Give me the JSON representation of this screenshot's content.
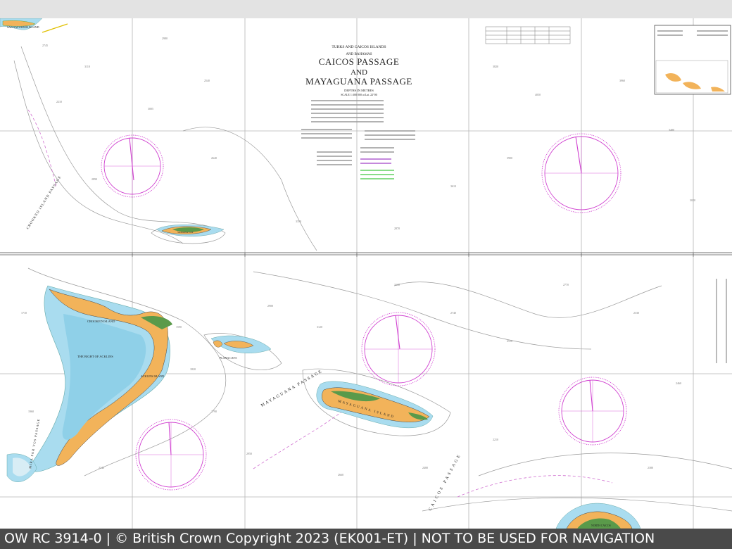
{
  "chart_title": {
    "region": "TURKS AND CAICOS ISLANDS",
    "subregion": "AND BAHAMAS",
    "line1": "CAICOS PASSAGE",
    "line2": "AND",
    "line3": "MAYAGUANA PASSAGE",
    "depths_note": "DEPTHS IN METRES",
    "scale": "SCALE 1:300 000 at Lat. 22°00"
  },
  "place_names": {
    "san_salvador": "SAN SALVADOR ISLAND",
    "crooked_passage": "CROOKED ISLAND PASSAGE",
    "crooked_island": "CROOKED ISLAND",
    "bight_of_acklins": "THE BIGHT OF ACKLINS",
    "acklins_island": "ACKLINS ISLAND",
    "plana_cays": "PLANA CAYS",
    "mayaguana_passage": "MAYAGUANA PASSAGE",
    "mayaguana_island": "MAYAGUANA ISLAND",
    "caicos_passage": "CAICOS PASSAGE",
    "north_caicos": "NORTH CAICOS",
    "samana_cay": "SAMANA CAY",
    "mira_por_vos": "MIRA POR VOS PASSAGE"
  },
  "colors": {
    "land": "#f2b35a",
    "vegetation": "#5a9a4a",
    "shallow": "#a9dcef",
    "compass": "#d040d0",
    "grid": "#9a9a9a"
  },
  "footer": {
    "text": "OW RC 3914-0 | © British Crown Copyright 2023 (EK001-ET) | NOT TO BE USED FOR NAVIGATION"
  }
}
